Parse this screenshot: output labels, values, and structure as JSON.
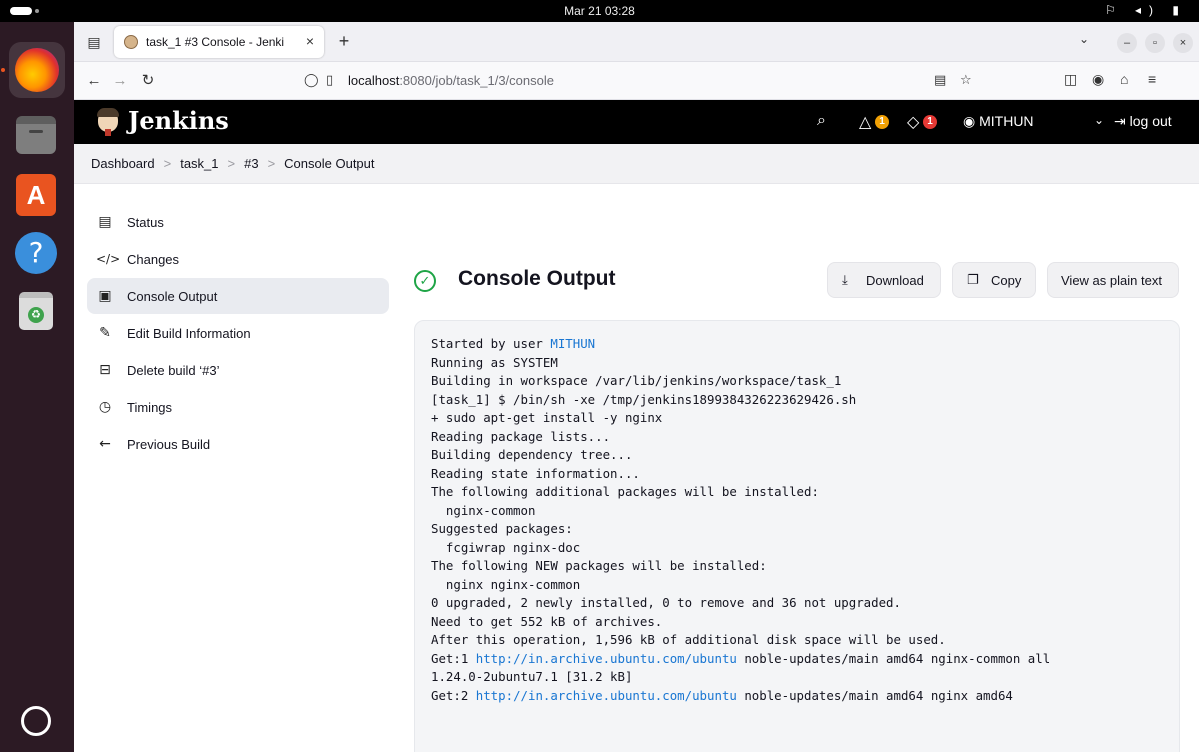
{
  "topbar": {
    "clock": "Mar 21  03:28",
    "tray": "⚐ ◂) ▮"
  },
  "browser": {
    "tab": {
      "title": "task_1 #3 Console - Jenki",
      "close": "×"
    },
    "newtab": "+",
    "url": {
      "host": "localhost",
      "rest": ":8080/job/task_1/3/console"
    }
  },
  "jenkins": {
    "brand": "Jenkins",
    "notifications_count": "1",
    "security_count": "1",
    "user": "MITHUN",
    "logout": "log out"
  },
  "breadcrumb": [
    "Dashboard",
    "task_1",
    "#3",
    "Console Output"
  ],
  "sidebar": {
    "items": [
      {
        "icon": "status-icon",
        "label": "Status"
      },
      {
        "icon": "code-icon",
        "label": "Changes"
      },
      {
        "icon": "terminal-icon",
        "label": "Console Output",
        "active": true
      },
      {
        "icon": "edit-icon",
        "label": "Edit Build Information"
      },
      {
        "icon": "trash-icon",
        "label": "Delete build ‘#3’"
      },
      {
        "icon": "timer-icon",
        "label": "Timings"
      },
      {
        "icon": "arrow-left-icon",
        "label": "Previous Build"
      }
    ]
  },
  "main": {
    "title": "Console Output",
    "status_color": "#1ea446",
    "buttons": {
      "download": "Download",
      "copy": "Copy",
      "plain": "View as plain text"
    }
  },
  "console": {
    "lines": [
      [
        "Started by user ",
        "MITHUN",
        ""
      ],
      [
        "Running as SYSTEM",
        "",
        ""
      ],
      [
        "Building in workspace /var/lib/jenkins/workspace/task_1",
        "",
        ""
      ],
      [
        "[task_1] $ /bin/sh -xe /tmp/jenkins1899384326223629426.sh",
        "",
        ""
      ],
      [
        "+ sudo apt-get install -y nginx",
        "",
        ""
      ],
      [
        "Reading package lists...",
        "",
        ""
      ],
      [
        "Building dependency tree...",
        "",
        ""
      ],
      [
        "Reading state information...",
        "",
        ""
      ],
      [
        "The following additional packages will be installed:",
        "",
        ""
      ],
      [
        "  nginx-common",
        "",
        ""
      ],
      [
        "Suggested packages:",
        "",
        ""
      ],
      [
        "  fcgiwrap nginx-doc",
        "",
        ""
      ],
      [
        "The following NEW packages will be installed:",
        "",
        ""
      ],
      [
        "  nginx nginx-common",
        "",
        ""
      ],
      [
        "0 upgraded, 2 newly installed, 0 to remove and 36 not upgraded.",
        "",
        ""
      ],
      [
        "Need to get 552 kB of archives.",
        "",
        ""
      ],
      [
        "After this operation, 1,596 kB of additional disk space will be used.",
        "",
        ""
      ],
      [
        "Get:1 ",
        "http://in.archive.ubuntu.com/ubuntu",
        " noble-updates/main amd64 nginx-common all"
      ],
      [
        "1.24.0-2ubuntu7.1 [31.2 kB]",
        "",
        ""
      ],
      [
        "Get:2 ",
        "http://in.archive.ubuntu.com/ubuntu",
        " noble-updates/main amd64 nginx amd64"
      ]
    ]
  }
}
